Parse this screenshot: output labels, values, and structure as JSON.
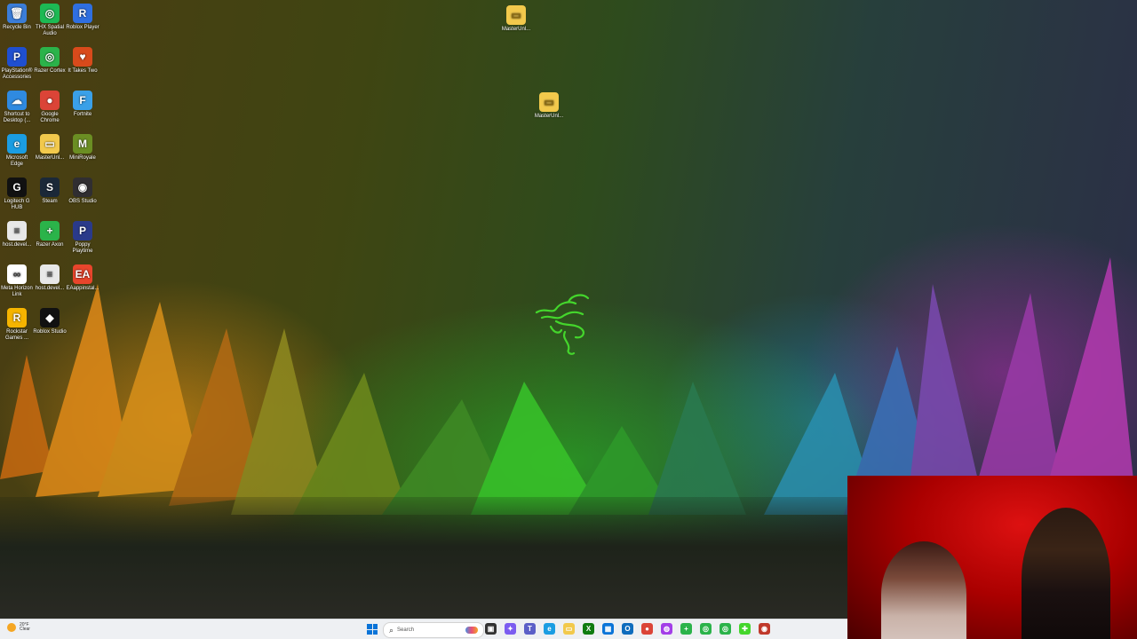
{
  "desktop": {
    "icons": [
      {
        "label": "Recycle Bin",
        "glyph": "🗑",
        "color": "#3b7dd8"
      },
      {
        "label": "THX Spatial Audio",
        "glyph": "◎",
        "color": "#1db954"
      },
      {
        "label": "Roblox Player",
        "glyph": "R",
        "color": "#2f6fe0"
      },
      {
        "label": "PlayStation® Accessories",
        "glyph": "P",
        "color": "#1f4fd0"
      },
      {
        "label": "Razer Cortex",
        "glyph": "◎",
        "color": "#2bb34a"
      },
      {
        "label": "It Takes Two",
        "glyph": "♥",
        "color": "#d84a1b"
      },
      {
        "label": "Shortcut to Desktop (...",
        "glyph": "☁",
        "color": "#2f8ae0"
      },
      {
        "label": "Google Chrome",
        "glyph": "●",
        "color": "#db4437"
      },
      {
        "label": "Fortnite",
        "glyph": "F",
        "color": "#3aa0e8"
      },
      {
        "label": "Microsoft Edge",
        "glyph": "e",
        "color": "#1b9de2"
      },
      {
        "label": "MasterUnl...",
        "glyph": "▭",
        "color": "#f2c94c"
      },
      {
        "label": "MiniRoyale",
        "glyph": "M",
        "color": "#6b8e23"
      },
      {
        "label": "Logitech G HUB",
        "glyph": "G",
        "color": "#111111"
      },
      {
        "label": "Steam",
        "glyph": "S",
        "color": "#1b2838"
      },
      {
        "label": "OBS Studio",
        "glyph": "◉",
        "color": "#302e31"
      },
      {
        "label": "host.devel...",
        "glyph": "≡",
        "color": "#e8e8e8"
      },
      {
        "label": "Razer Axon",
        "glyph": "+",
        "color": "#2bb34a"
      },
      {
        "label": "Poppy Playtime",
        "glyph": "P",
        "color": "#2a3a8a"
      },
      {
        "label": "Meta Horizon Link",
        "glyph": "∞",
        "color": "#ffffff"
      },
      {
        "label": "host.devel...",
        "glyph": "≡",
        "color": "#e8e8e8"
      },
      {
        "label": "EAappinstal...",
        "glyph": "EA",
        "color": "#e8452c"
      },
      {
        "label": "Rockstar Games ...",
        "glyph": "R",
        "color": "#f5b400"
      },
      {
        "label": "Roblox Studio",
        "glyph": "◆",
        "color": "#111111"
      }
    ],
    "floating_icons": [
      {
        "label": "MasterUnl...",
        "glyph": "▭",
        "color": "#f2c94c"
      },
      {
        "label": "MasterUnl...",
        "glyph": "▭",
        "color": "#f2c94c"
      }
    ]
  },
  "taskbar": {
    "weather_temp": "20°F",
    "weather_desc": "Clear",
    "search_placeholder": "Search",
    "apps": [
      {
        "name": "task-view",
        "glyph": "▣",
        "color": "#333333"
      },
      {
        "name": "copilot",
        "glyph": "✦",
        "color": "#7b5cf0"
      },
      {
        "name": "teams",
        "glyph": "T",
        "color": "#5b5fc7"
      },
      {
        "name": "edge",
        "glyph": "e",
        "color": "#1b9de2"
      },
      {
        "name": "file-explorer",
        "glyph": "▭",
        "color": "#f2c94c"
      },
      {
        "name": "xbox",
        "glyph": "X",
        "color": "#107c10"
      },
      {
        "name": "store",
        "glyph": "▦",
        "color": "#0a74d8"
      },
      {
        "name": "outlook",
        "glyph": "O",
        "color": "#0f6cbd"
      },
      {
        "name": "chrome",
        "glyph": "●",
        "color": "#db4437"
      },
      {
        "name": "messenger",
        "glyph": "◍",
        "color": "#a33ee8"
      },
      {
        "name": "razer-axon",
        "glyph": "+",
        "color": "#2bb34a"
      },
      {
        "name": "razer-cortex",
        "glyph": "◎",
        "color": "#2bb34a"
      },
      {
        "name": "razer-synapse",
        "glyph": "◎",
        "color": "#2bb34a"
      },
      {
        "name": "razer-app",
        "glyph": "✚",
        "color": "#44d62c"
      },
      {
        "name": "obs-record",
        "glyph": "◉",
        "color": "#c0392b"
      }
    ]
  },
  "colors": {
    "razer_green": "#44d62c"
  }
}
